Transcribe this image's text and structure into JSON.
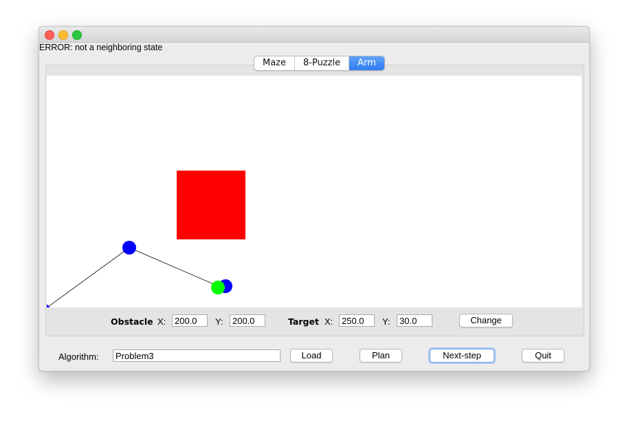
{
  "window": {
    "title": ""
  },
  "status": {
    "message": "ERROR: not a neighboring state"
  },
  "tabs": [
    {
      "label": "Maze",
      "active": false
    },
    {
      "label": "8-Puzzle",
      "active": false
    },
    {
      "label": "Arm",
      "active": true
    }
  ],
  "scene": {
    "obstacle_color": "#ff0000",
    "joint_color": "#0000ff",
    "target_color": "#00ff00",
    "link_color": "#000000"
  },
  "obstacle": {
    "label": "Obstacle",
    "x_label": "X:",
    "x_value": "200.0",
    "y_label": "Y:",
    "y_value": "200.0"
  },
  "target": {
    "label": "Target",
    "x_label": "X:",
    "x_value": "250.0",
    "y_label": "Y:",
    "y_value": "30.0"
  },
  "change_button": "Change",
  "algorithm": {
    "label": "Algorithm:",
    "value": "Problem3"
  },
  "buttons": {
    "load": "Load",
    "plan": "Plan",
    "next_step": "Next-step",
    "quit": "Quit"
  }
}
